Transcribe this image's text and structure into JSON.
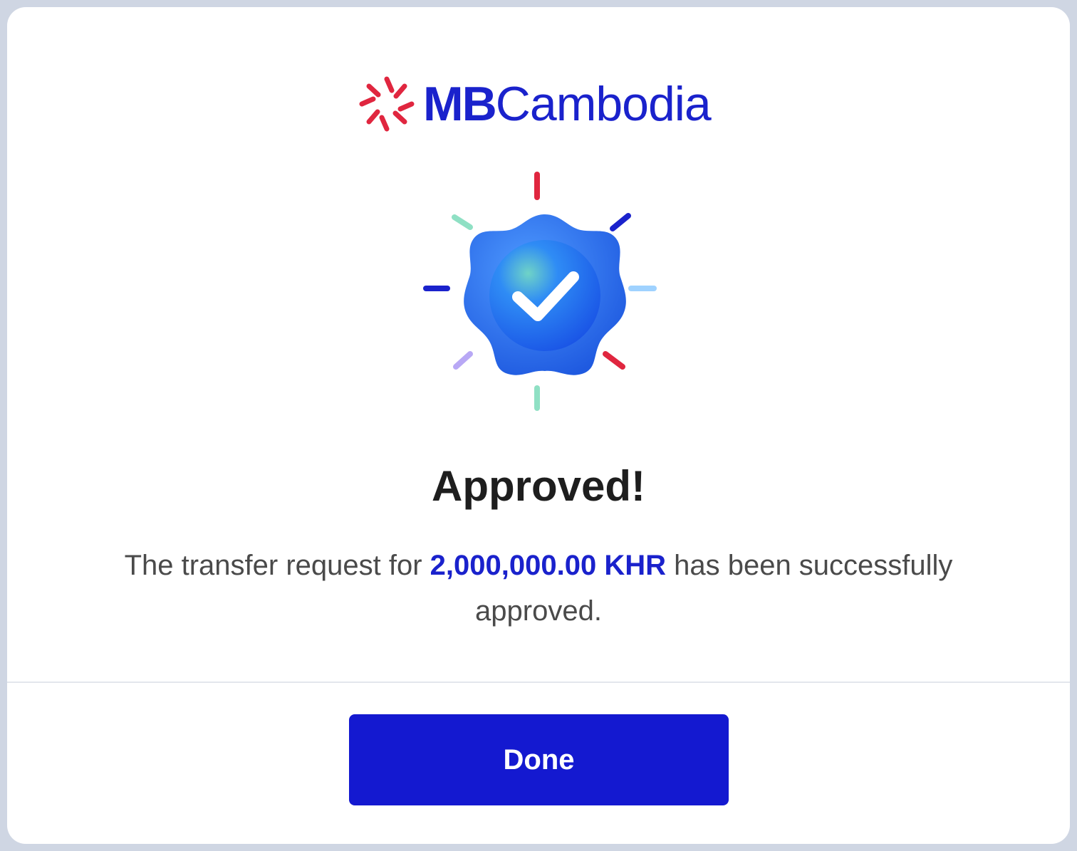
{
  "brand": {
    "name_bold": "MB",
    "name_regular": "Cambodia",
    "color": "#1a22cc",
    "mark_color": "#e0263f",
    "mark_icon": "star-burst-logo-icon"
  },
  "status": {
    "icon": "verified-badge-check-icon",
    "title": "Approved!"
  },
  "message": {
    "prefix": "The transfer request for ",
    "amount": "2,000,000.00 KHR",
    "suffix": " has been successfully approved."
  },
  "actions": {
    "done_label": "Done"
  },
  "colors": {
    "primary": "#1419d0",
    "badge": "#2b6ff0",
    "ray_red": "#e0263f",
    "ray_navy": "#1a22cc",
    "ray_green": "#8fe0c4",
    "ray_lightblue": "#9fd2ff",
    "ray_purple": "#b8a8f5"
  }
}
